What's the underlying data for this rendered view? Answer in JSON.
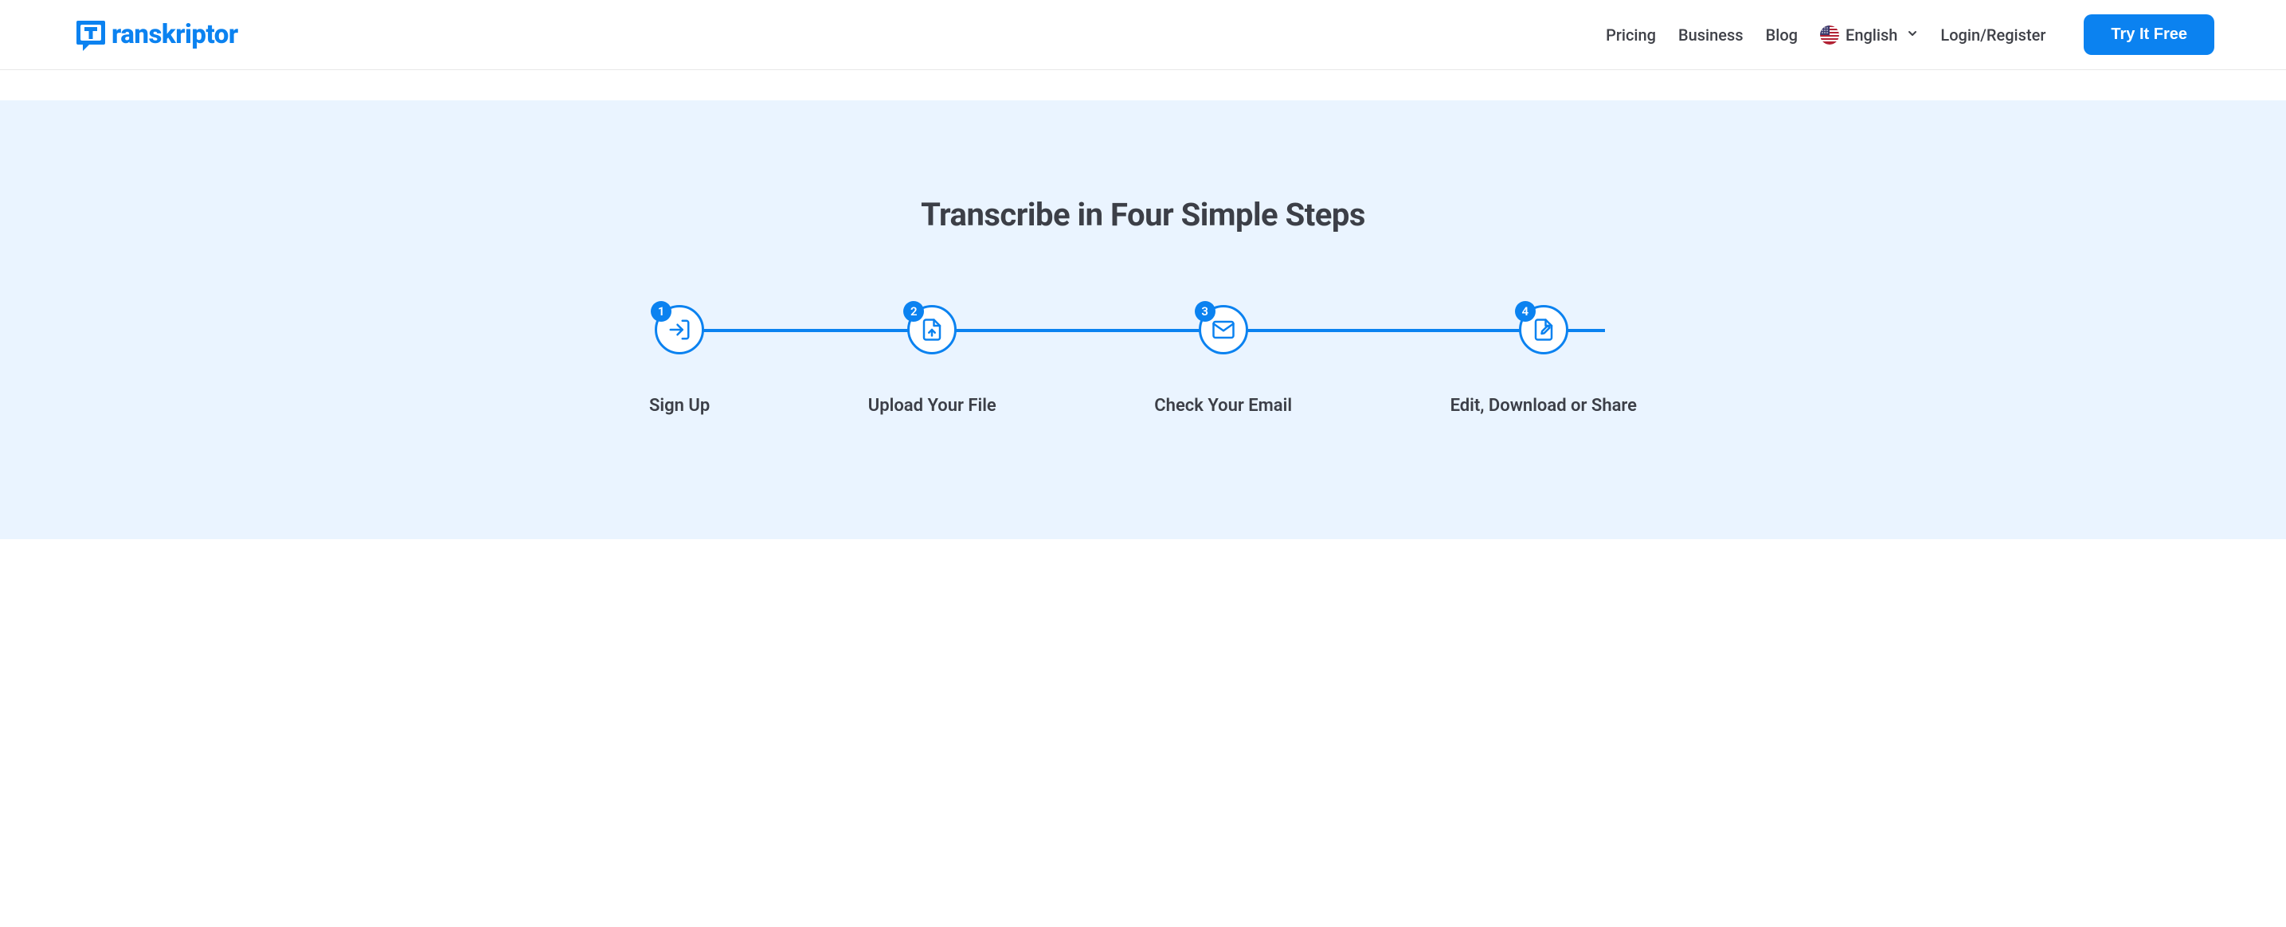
{
  "logo": {
    "text": "ranskriptor"
  },
  "nav": {
    "pricing": "Pricing",
    "business": "Business",
    "blog": "Blog",
    "language": "English",
    "login": "Login/Register"
  },
  "cta": {
    "label": "Try It Free"
  },
  "hero": {
    "title": "Transcribe in Four Simple Steps"
  },
  "steps": [
    {
      "number": "1",
      "label": "Sign Up"
    },
    {
      "number": "2",
      "label": "Upload Your File"
    },
    {
      "number": "3",
      "label": "Check Your Email"
    },
    {
      "number": "4",
      "label": "Edit, Download or Share"
    }
  ]
}
